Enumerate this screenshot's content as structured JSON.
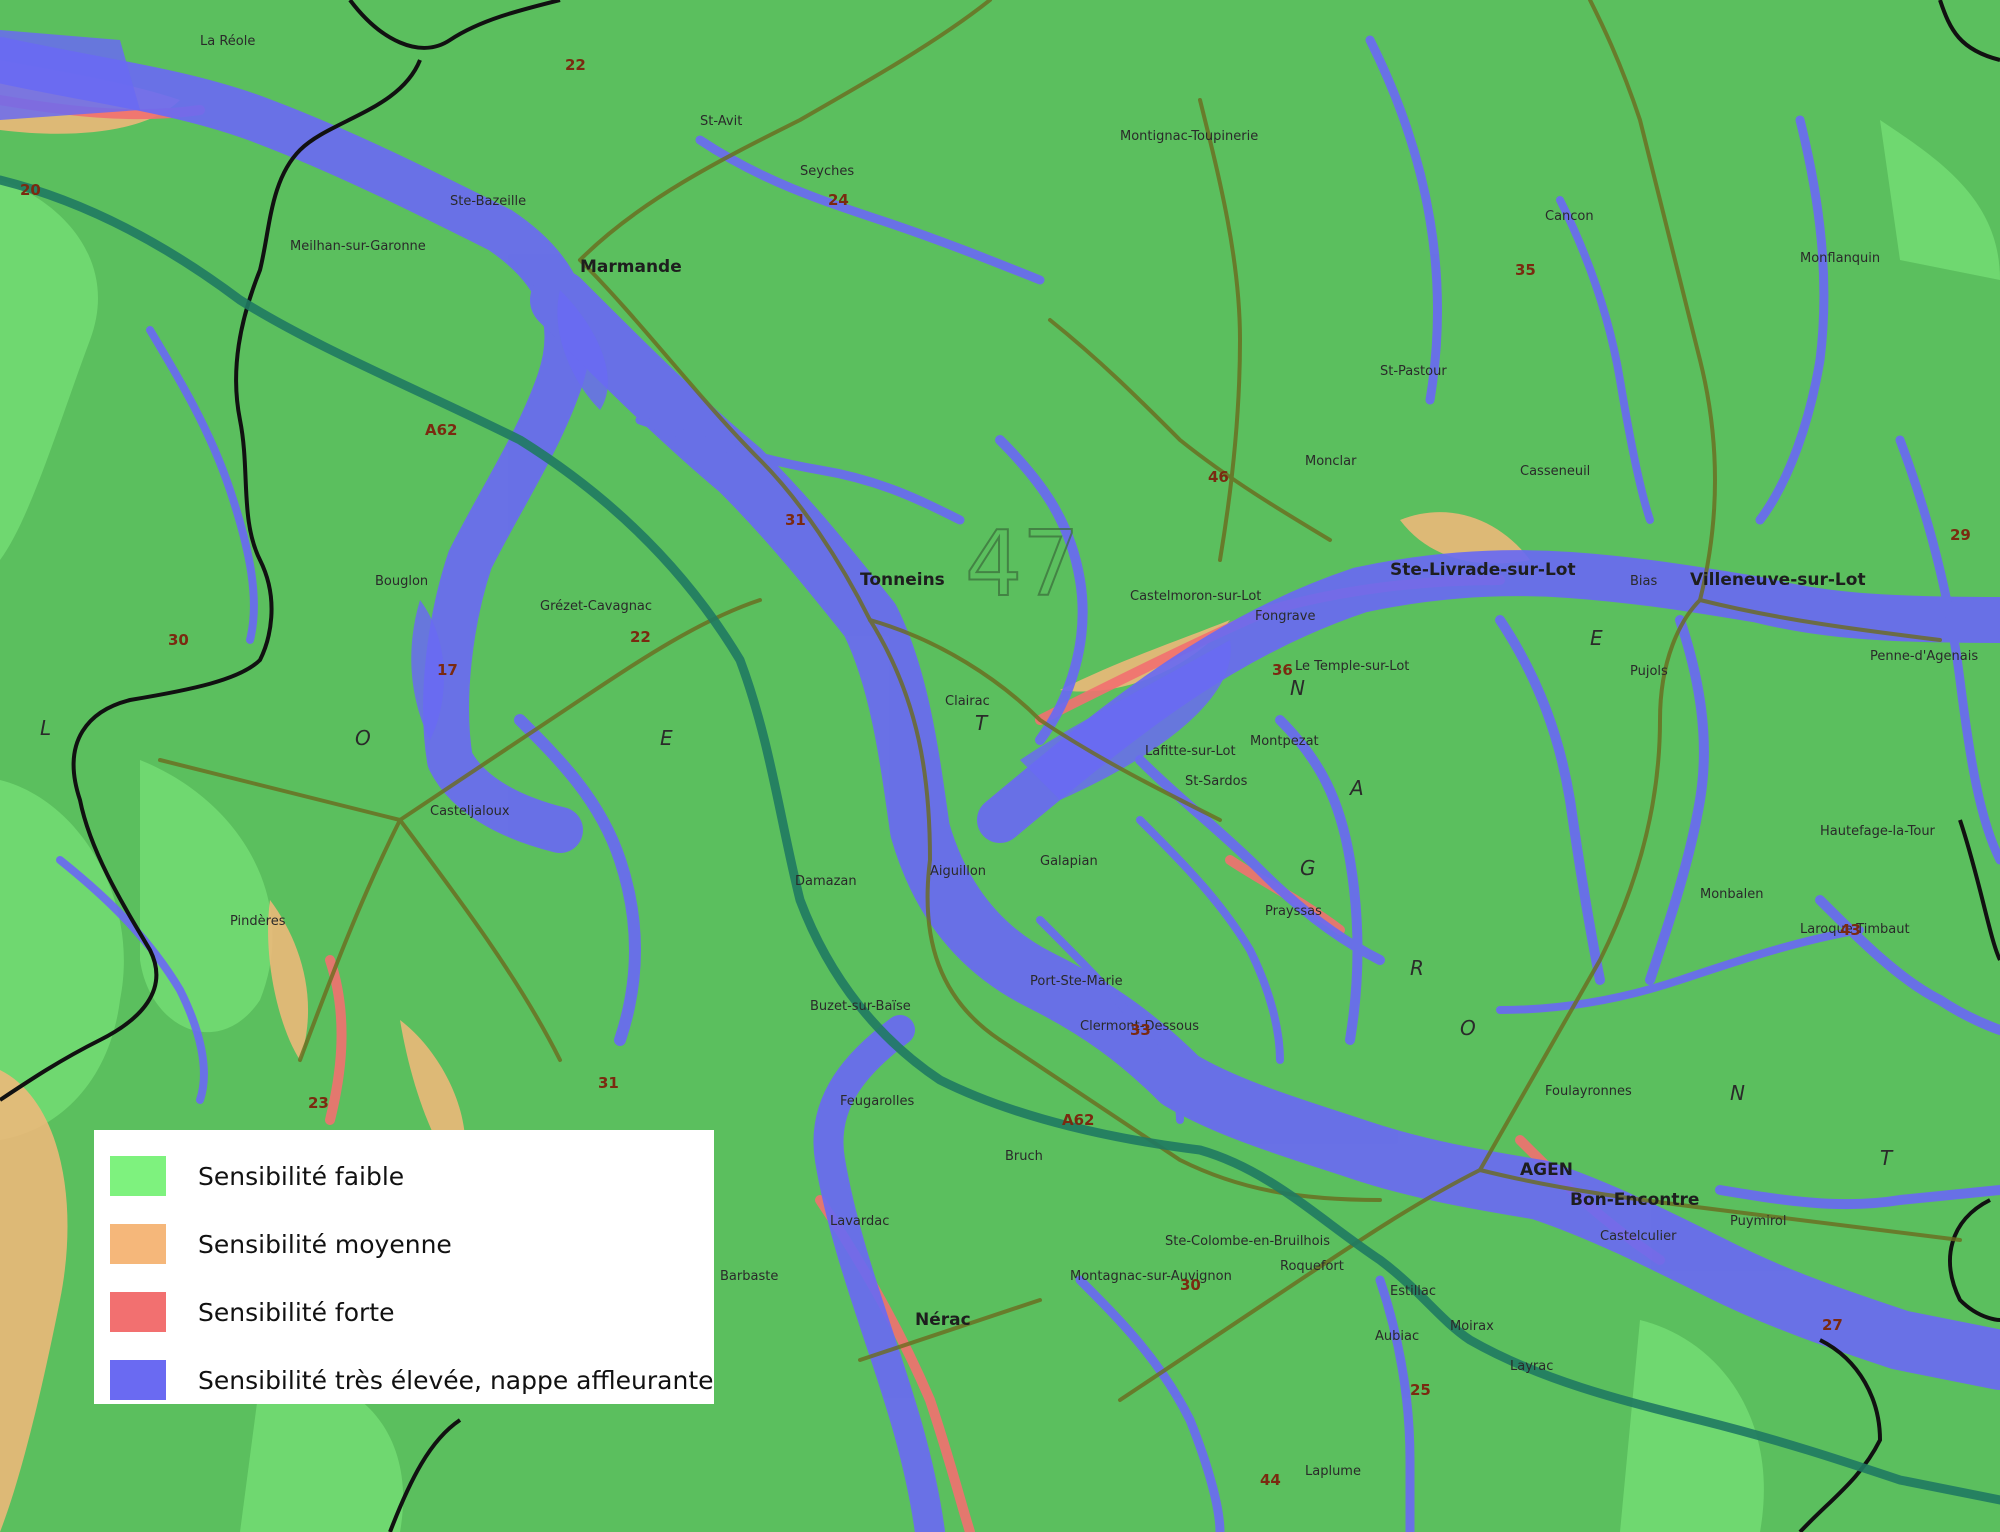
{
  "legend": {
    "items": [
      {
        "label": "Sensibilité faible",
        "color": "#7ef27e"
      },
      {
        "label": "Sensibilité moyenne",
        "color": "#f5b77a"
      },
      {
        "label": "Sensibilité forte",
        "color": "#f27070"
      },
      {
        "label": "Sensibilité très élevée, nappe affleurante",
        "color": "#6a6af2"
      }
    ]
  },
  "map": {
    "colors": {
      "base": "#5bbf5e",
      "high": "#6a6af2",
      "medium": "#f5b77a",
      "strong": "#f27070",
      "road": "#6b6b1e",
      "motorway": "#1f7a62",
      "boundary": "#111111"
    },
    "department_label": "47",
    "region_letters": [
      "L",
      "O",
      "T",
      "E",
      "T",
      "G",
      "A",
      "R",
      "O",
      "N",
      "N",
      "E"
    ],
    "places": {
      "marmande": "Marmande",
      "tonneins": "Tonneins",
      "agen": "AGEN",
      "villeneuve": "Villeneuve-sur-Lot",
      "ste_livrade": "Ste-Livrade-sur-Lot",
      "nerac": "Nérac",
      "bon_encontre": "Bon-Encontre",
      "aiguillon": "Aiguillon",
      "damazan": "Damazan",
      "casteljaloux": "Casteljaloux",
      "clairac": "Clairac",
      "castelmoron": "Castelmoron-sur-Lot",
      "le_temple": "Le Temple-sur-Lot",
      "port_ste_marie": "Port-Ste-Marie",
      "lavardac": "Lavardac",
      "cancon": "Cancon",
      "monflanquin": "Monflanquin",
      "seyches": "Seyches",
      "miramont": "St-Avit",
      "penne": "Penne-d'Agenais",
      "prayssas": "Prayssas",
      "layrac": "Layrac",
      "estillac": "Estillac",
      "ste_bazeille": "Ste-Bazeille",
      "meilhan": "Meilhan-sur-Garonne",
      "grezet": "Grézet-Cavagnac",
      "bouglon": "Bouglon",
      "buzet": "Buzet-sur-Baïse",
      "mezin": "Montagnac-sur-Auvignon",
      "laplume": "Laplume",
      "astaffort": "Roquefort",
      "francescas": "Barbaste",
      "houeilles": "Pindères",
      "bruch": "Bruch",
      "pujols": "Pujols",
      "monbalen": "Monbalen",
      "laroque": "Laroque-Timbaut",
      "foulayronnes": "Foulayronnes",
      "la_reole": "La Réole",
      "castillonnes": "St-Pastour",
      "lauzun": "Montignac-Toupinerie",
      "monclar": "Monclar",
      "fongrave": "Fongrave",
      "bias": "Bias",
      "casseneuil": "Casseneuil",
      "lafitte": "Lafitte-sur-Lot",
      "st_sardos": "St-Sardos",
      "montpezat": "Montpezat",
      "galapian": "Galapian",
      "clermont_dessous": "Clermont-Dessous",
      "feugarolles": "Feugarolles",
      "moncrabeau": "Ste-Colombe-en-Bruilhois",
      "aubiac": "Aubiac",
      "moirax": "Moirax",
      "castelculier": "Castelculier",
      "puymirol": "Puymirol",
      "fumel": "Hautefage-la-Tour"
    },
    "road_numbers": [
      "22",
      "24",
      "35",
      "46",
      "31",
      "17",
      "20",
      "30",
      "23",
      "31",
      "36",
      "33",
      "25",
      "27",
      "44",
      "30",
      "29",
      "43",
      "22"
    ],
    "motorway_label": "A62"
  }
}
